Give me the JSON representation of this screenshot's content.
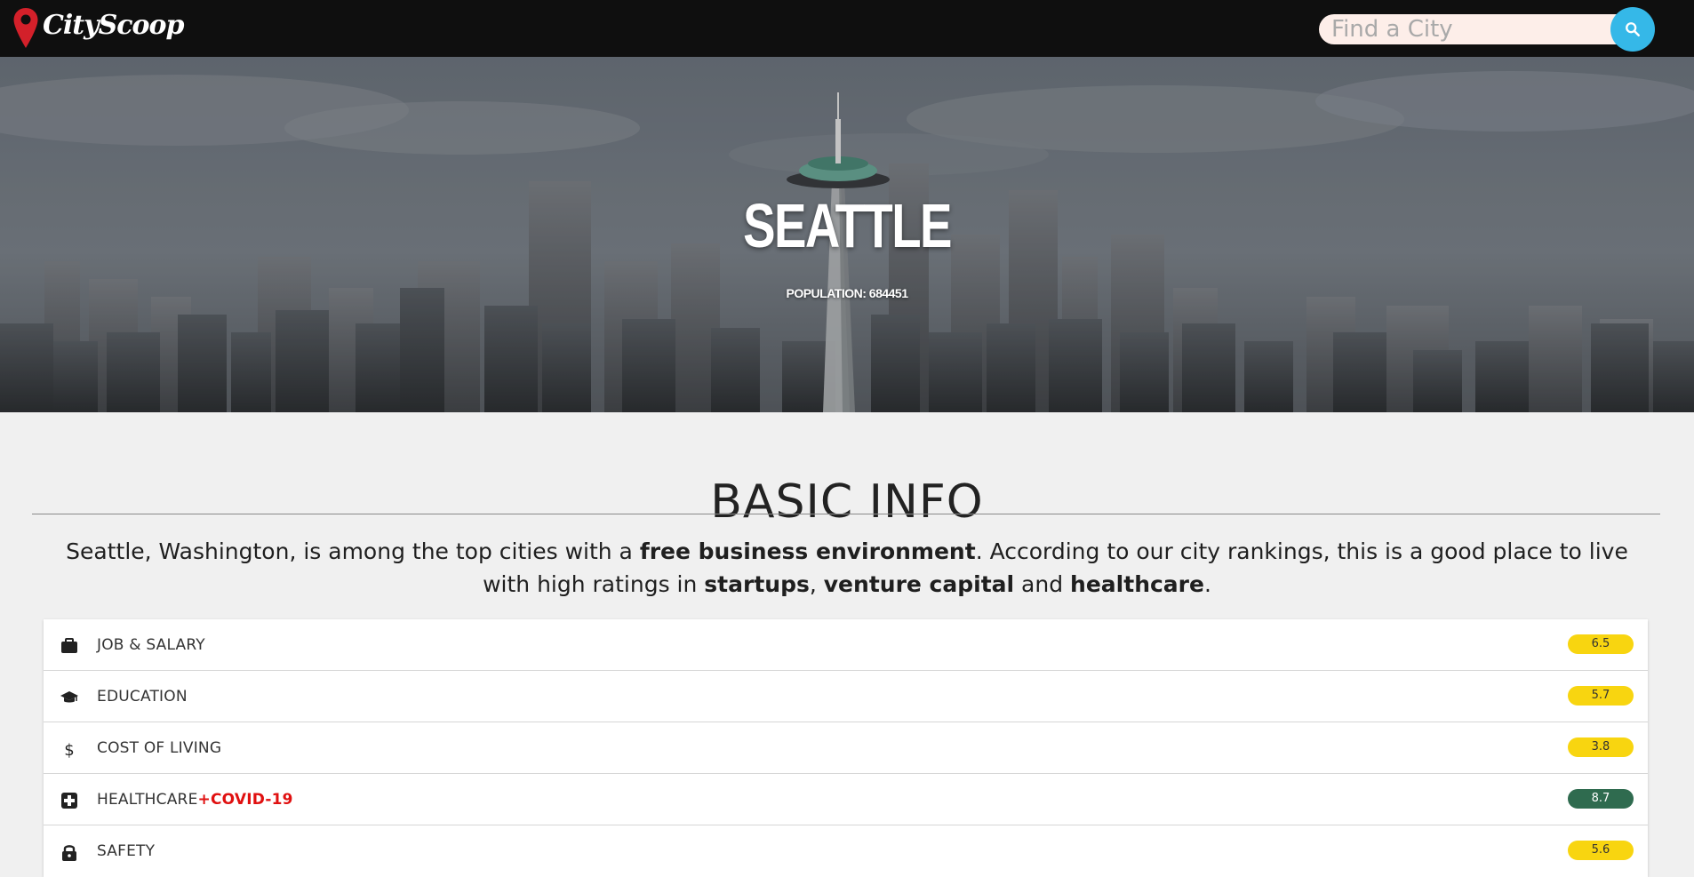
{
  "nav": {
    "logo_text": "CityScoop",
    "search_placeholder": "Find a City"
  },
  "hero": {
    "city": "SEATTLE",
    "population_label": "POPULATION: 684451"
  },
  "basic_info": {
    "title": "BASIC INFO",
    "summary": {
      "part1": "Seattle, Washington, is among the top cities with a ",
      "bold1": "free business environment",
      "part2": ". According to our city rankings, this is a good place to live with high ratings in ",
      "bold2": "startups",
      "part3": ", ",
      "bold3": "venture capital",
      "part4": " and ",
      "bold4": "healthcare",
      "part5": "."
    }
  },
  "ratings": [
    {
      "label": "JOB & SALARY",
      "extra": "",
      "score": "6.5",
      "icon": "briefcase-icon",
      "badge_color": "#f8d510",
      "text_color": "#333333"
    },
    {
      "label": "EDUCATION",
      "extra": "",
      "score": "5.7",
      "icon": "graduation-cap-icon",
      "badge_color": "#f8d510",
      "text_color": "#333333"
    },
    {
      "label": "COST OF LIVING",
      "extra": "",
      "score": "3.8",
      "icon": "dollar-icon",
      "badge_color": "#f8d510",
      "text_color": "#333333"
    },
    {
      "label": "HEALTHCARE",
      "extra": "+COVID-19",
      "score": "8.7",
      "icon": "medical-cross-icon",
      "badge_color": "#2f6b4f",
      "text_color": "#ffffff"
    },
    {
      "label": "SAFETY",
      "extra": "",
      "score": "5.6",
      "icon": "lock-icon",
      "badge_color": "#f8d510",
      "text_color": "#333333"
    }
  ],
  "colors": {
    "nav_bg": "#0f0f0f",
    "search_button": "#35b8e8",
    "logo_pin": "#d3202a",
    "covid_red": "#e01010",
    "page_bg": "#f0f0f0"
  }
}
